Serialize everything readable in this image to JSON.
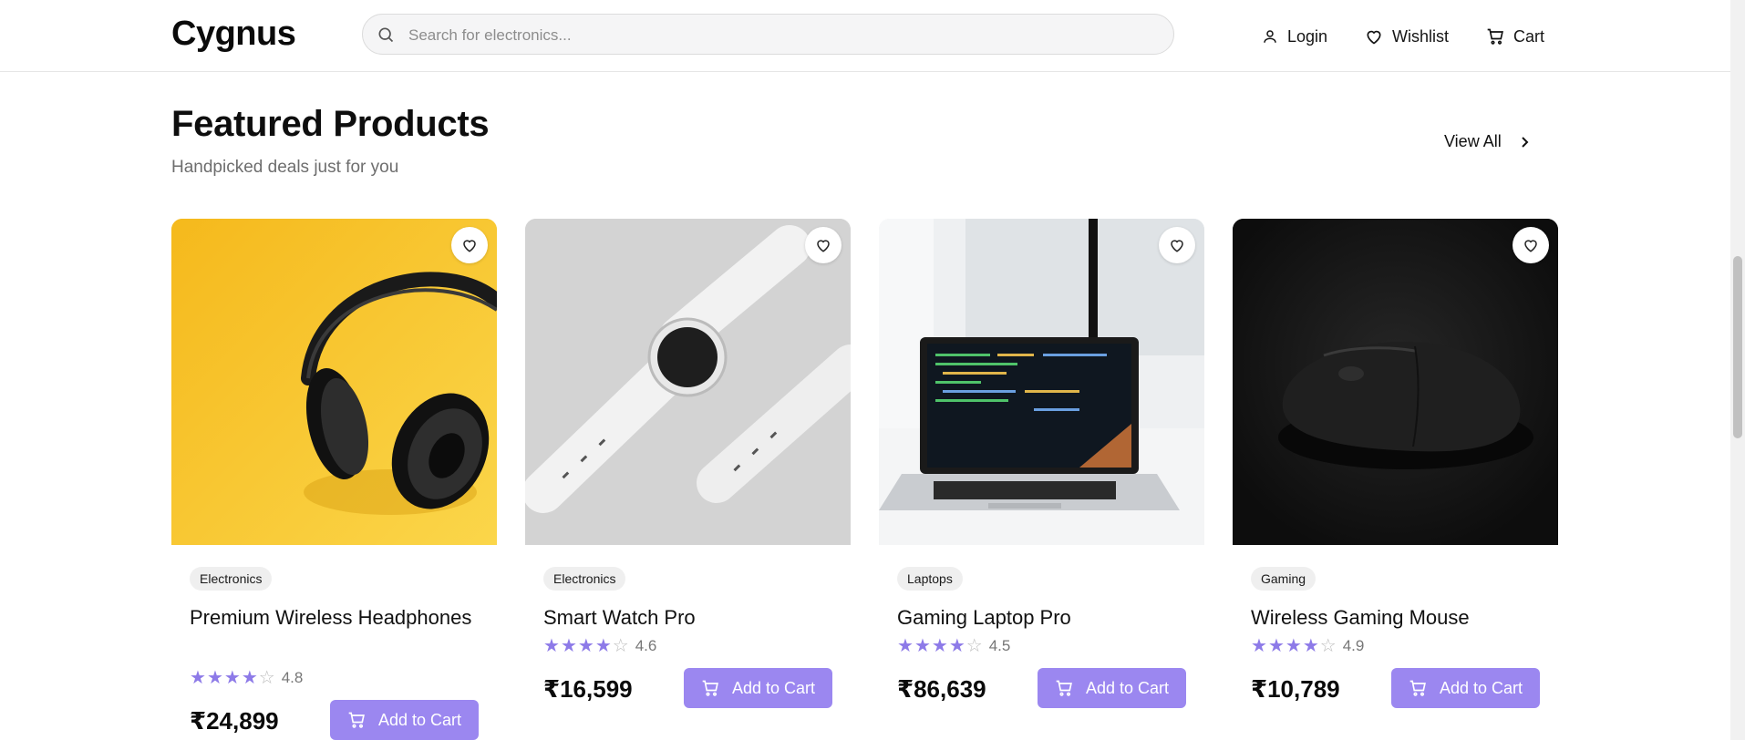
{
  "header": {
    "logo": "Cygnus",
    "search_placeholder": "Search for electronics...",
    "nav": {
      "login": "Login",
      "wishlist": "Wishlist",
      "cart": "Cart"
    }
  },
  "section": {
    "title": "Featured Products",
    "subtitle": "Handpicked deals just for you",
    "view_all": "View All"
  },
  "products": [
    {
      "category": "Electronics",
      "name": "Premium Wireless Headphones",
      "rating": "4.8",
      "stars": 4,
      "price": "₹24,899",
      "button": "Add to Cart",
      "image": "headphones-image"
    },
    {
      "category": "Electronics",
      "name": "Smart Watch Pro",
      "rating": "4.6",
      "stars": 4,
      "price": "₹16,599",
      "button": "Add to Cart",
      "image": "smartwatch-image"
    },
    {
      "category": "Laptops",
      "name": "Gaming Laptop Pro",
      "rating": "4.5",
      "stars": 4,
      "price": "₹86,639",
      "button": "Add to Cart",
      "image": "laptop-image"
    },
    {
      "category": "Gaming",
      "name": "Wireless Gaming Mouse",
      "rating": "4.9",
      "stars": 4,
      "price": "₹10,789",
      "button": "Add to Cart",
      "image": "mouse-image"
    }
  ],
  "colors": {
    "accent": "#9b87f0",
    "star": "#8d7ae8",
    "text": "#111111"
  }
}
